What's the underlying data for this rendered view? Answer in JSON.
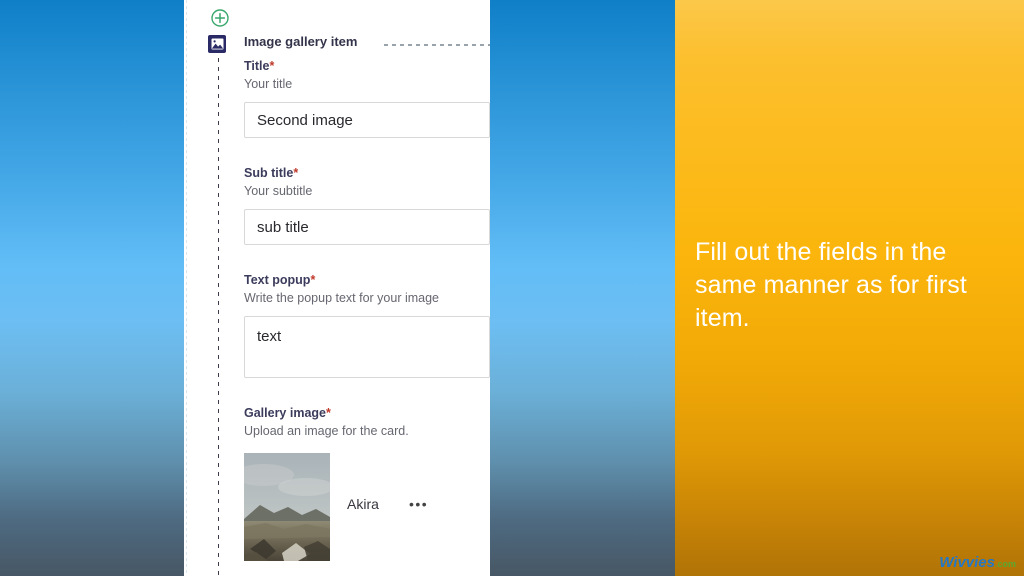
{
  "form": {
    "add_button_label": "+",
    "item_type_label": "Image gallery item",
    "item_icon": "image-gallery-icon",
    "add_icon": "circle-plus-icon",
    "fields": [
      {
        "label": "Title",
        "required_marker": "*",
        "description": "Your title",
        "value": "Second image",
        "placeholder": "Your title",
        "control": "text"
      },
      {
        "label": "Sub title",
        "required_marker": "*",
        "description": "Your subtitle",
        "value": "sub title",
        "placeholder": "Your subtitle",
        "control": "text"
      },
      {
        "label": "Text popup",
        "required_marker": "*",
        "description": "Write the popup text for your image",
        "value": "text",
        "placeholder": "Write the popup text for your image",
        "control": "textarea"
      },
      {
        "label": "Gallery image",
        "required_marker": "*",
        "description": "Upload an image for the card.",
        "control": "file"
      }
    ],
    "uploaded_file": {
      "name": "Akira",
      "menu_label": "•••",
      "thumbnail_alt": "rocky landscape under cloudy sky"
    }
  },
  "callout": {
    "text": "Fill out the fields in the same manner as for first item."
  },
  "watermark": {
    "brand": "Wivvies",
    "tld": ".com"
  },
  "colors": {
    "panel_background": "#ffffff",
    "callout_orange_top": "#fcc84a",
    "callout_orange_bottom": "#b07306",
    "backdrop_blue_top": "#0f7fc8",
    "backdrop_blue_bottom": "#475765",
    "label_text": "#3b3b5c",
    "required_star": "#c0392b",
    "add_icon_green": "#3aa76d",
    "item_icon_navy": "#2a2a66",
    "watermark_brand": "#2478c8",
    "watermark_tld": "#5aa832"
  }
}
